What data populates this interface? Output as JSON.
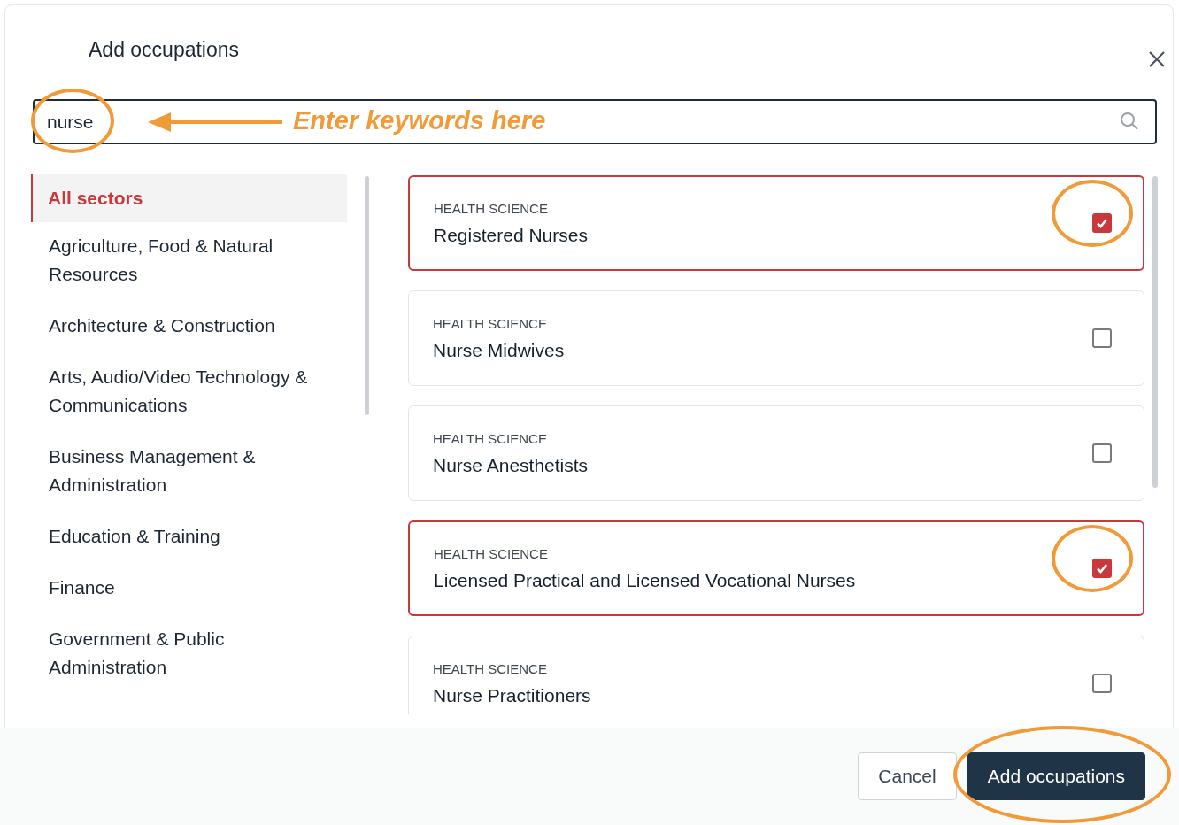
{
  "dialog": {
    "title": "Add occupations"
  },
  "search": {
    "value": "nurse",
    "value_circled": true,
    "annotation": "Enter keywords here"
  },
  "sectors": [
    {
      "label": "All sectors",
      "selected": true
    },
    {
      "label": "Agriculture, Food & Natural Resources",
      "selected": false
    },
    {
      "label": "Architecture & Construction",
      "selected": false
    },
    {
      "label": "Arts, Audio/Video Technology & Communications",
      "selected": false
    },
    {
      "label": "Business Management & Administration",
      "selected": false
    },
    {
      "label": "Education & Training",
      "selected": false
    },
    {
      "label": "Finance",
      "selected": false
    },
    {
      "label": "Government & Public Administration",
      "selected": false
    }
  ],
  "occupations": [
    {
      "category": "HEALTH SCIENCE",
      "title": "Registered Nurses",
      "checked": true,
      "circled": true
    },
    {
      "category": "HEALTH SCIENCE",
      "title": "Nurse Midwives",
      "checked": false,
      "circled": false
    },
    {
      "category": "HEALTH SCIENCE",
      "title": "Nurse Anesthetists",
      "checked": false,
      "circled": false
    },
    {
      "category": "HEALTH SCIENCE",
      "title": "Licensed Practical and Licensed Vocational Nurses",
      "checked": true,
      "circled": true
    },
    {
      "category": "HEALTH SCIENCE",
      "title": "Nurse Practitioners",
      "checked": false,
      "circled": false
    }
  ],
  "buttons": [
    {
      "label": "Cancel",
      "kind": "secondary",
      "circled": false
    },
    {
      "label": "Add occupations",
      "kind": "primary",
      "circled": true
    }
  ]
}
